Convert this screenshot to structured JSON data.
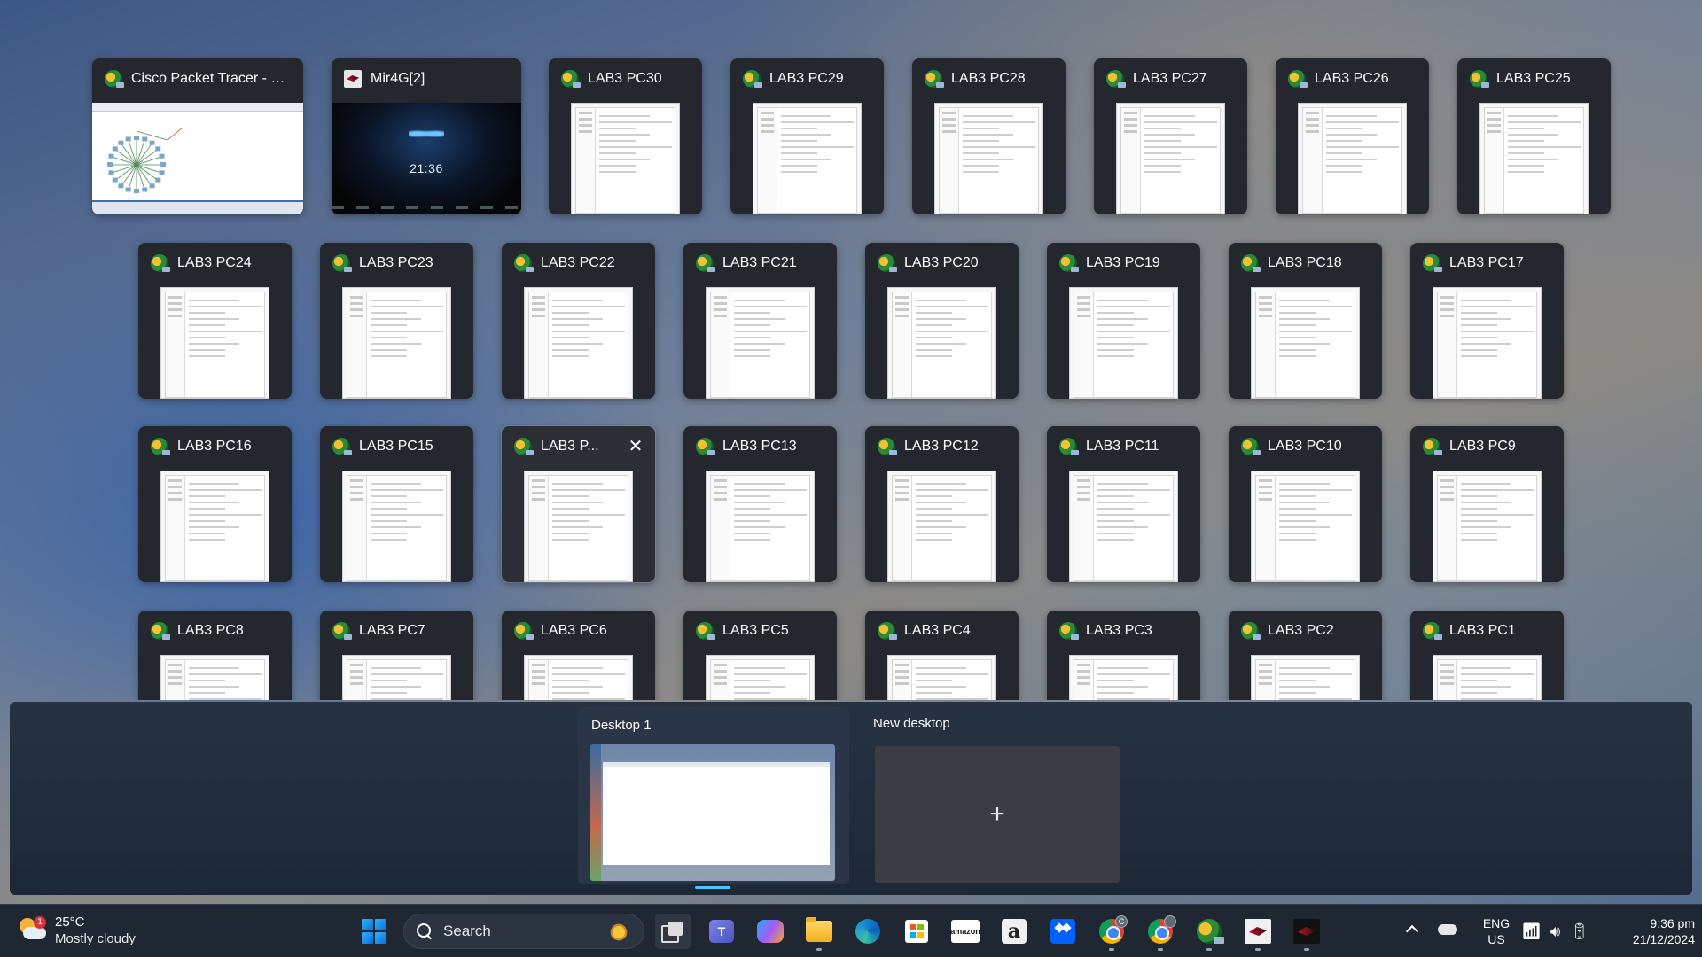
{
  "windows": [
    {
      "title": "Cisco Packet Tracer - C:\\...",
      "icon": "packet-tracer-icon",
      "kind": "cisco"
    },
    {
      "title": "Mir4G[2]",
      "icon": "mir4-icon",
      "kind": "mir4",
      "thumb_time": "21:36"
    },
    {
      "title": "LAB3 PC30",
      "icon": "packet-tracer-icon",
      "kind": "pc"
    },
    {
      "title": "LAB3 PC29",
      "icon": "packet-tracer-icon",
      "kind": "pc"
    },
    {
      "title": "LAB3 PC28",
      "icon": "packet-tracer-icon",
      "kind": "pc"
    },
    {
      "title": "LAB3 PC27",
      "icon": "packet-tracer-icon",
      "kind": "pc"
    },
    {
      "title": "LAB3 PC26",
      "icon": "packet-tracer-icon",
      "kind": "pc"
    },
    {
      "title": "LAB3 PC25",
      "icon": "packet-tracer-icon",
      "kind": "pc"
    },
    {
      "title": "LAB3 PC24",
      "icon": "packet-tracer-icon",
      "kind": "pc"
    },
    {
      "title": "LAB3 PC23",
      "icon": "packet-tracer-icon",
      "kind": "pc"
    },
    {
      "title": "LAB3 PC22",
      "icon": "packet-tracer-icon",
      "kind": "pc"
    },
    {
      "title": "LAB3 PC21",
      "icon": "packet-tracer-icon",
      "kind": "pc"
    },
    {
      "title": "LAB3 PC20",
      "icon": "packet-tracer-icon",
      "kind": "pc"
    },
    {
      "title": "LAB3 PC19",
      "icon": "packet-tracer-icon",
      "kind": "pc"
    },
    {
      "title": "LAB3 PC18",
      "icon": "packet-tracer-icon",
      "kind": "pc"
    },
    {
      "title": "LAB3 PC17",
      "icon": "packet-tracer-icon",
      "kind": "pc"
    },
    {
      "title": "LAB3 PC16",
      "icon": "packet-tracer-icon",
      "kind": "pc"
    },
    {
      "title": "LAB3 PC15",
      "icon": "packet-tracer-icon",
      "kind": "pc"
    },
    {
      "title": "LAB3 P...",
      "icon": "packet-tracer-icon",
      "kind": "pc",
      "selected": true
    },
    {
      "title": "LAB3 PC13",
      "icon": "packet-tracer-icon",
      "kind": "pc"
    },
    {
      "title": "LAB3 PC12",
      "icon": "packet-tracer-icon",
      "kind": "pc"
    },
    {
      "title": "LAB3 PC11",
      "icon": "packet-tracer-icon",
      "kind": "pc"
    },
    {
      "title": "LAB3 PC10",
      "icon": "packet-tracer-icon",
      "kind": "pc"
    },
    {
      "title": "LAB3 PC9",
      "icon": "packet-tracer-icon",
      "kind": "pc"
    },
    {
      "title": "LAB3 PC8",
      "icon": "packet-tracer-icon",
      "kind": "pc"
    },
    {
      "title": "LAB3 PC7",
      "icon": "packet-tracer-icon",
      "kind": "pc"
    },
    {
      "title": "LAB3 PC6",
      "icon": "packet-tracer-icon",
      "kind": "pc"
    },
    {
      "title": "LAB3 PC5",
      "icon": "packet-tracer-icon",
      "kind": "pc"
    },
    {
      "title": "LAB3 PC4",
      "icon": "packet-tracer-icon",
      "kind": "pc"
    },
    {
      "title": "LAB3 PC3",
      "icon": "packet-tracer-icon",
      "kind": "pc"
    },
    {
      "title": "LAB3 PC2",
      "icon": "packet-tracer-icon",
      "kind": "pc"
    },
    {
      "title": "LAB3 PC1",
      "icon": "packet-tracer-icon",
      "kind": "pc"
    }
  ],
  "desktops": {
    "current": {
      "label": "Desktop 1"
    },
    "new": {
      "label": "New desktop",
      "plus": "+"
    }
  },
  "taskbar": {
    "weather": {
      "badge": "1",
      "temp": "25°C",
      "desc": "Mostly cloudy"
    },
    "search": {
      "placeholder": "Search"
    },
    "apps": [
      "start-icon",
      "search-box",
      "task-view-icon",
      "teams-icon",
      "copilot-icon",
      "file-explorer-icon",
      "edge-icon",
      "microsoft-store-icon",
      "amazon-icon",
      "amazon-a-icon",
      "dropbox-icon",
      "chrome-icon",
      "chrome-profile-icon",
      "packet-tracer-icon",
      "mir4-icon",
      "mir4-dark-icon"
    ],
    "chrome_badge": "C",
    "amazon_text": "amazon",
    "amazon_a": "a",
    "tray": {
      "lang_1": "ENG",
      "lang_2": "US",
      "time": "9:36 pm",
      "date": "21/12/2024",
      "icons": [
        "chevron-up-icon",
        "onedrive-icon",
        "wifi-icon",
        "volume-icon",
        "battery-icon"
      ]
    }
  }
}
